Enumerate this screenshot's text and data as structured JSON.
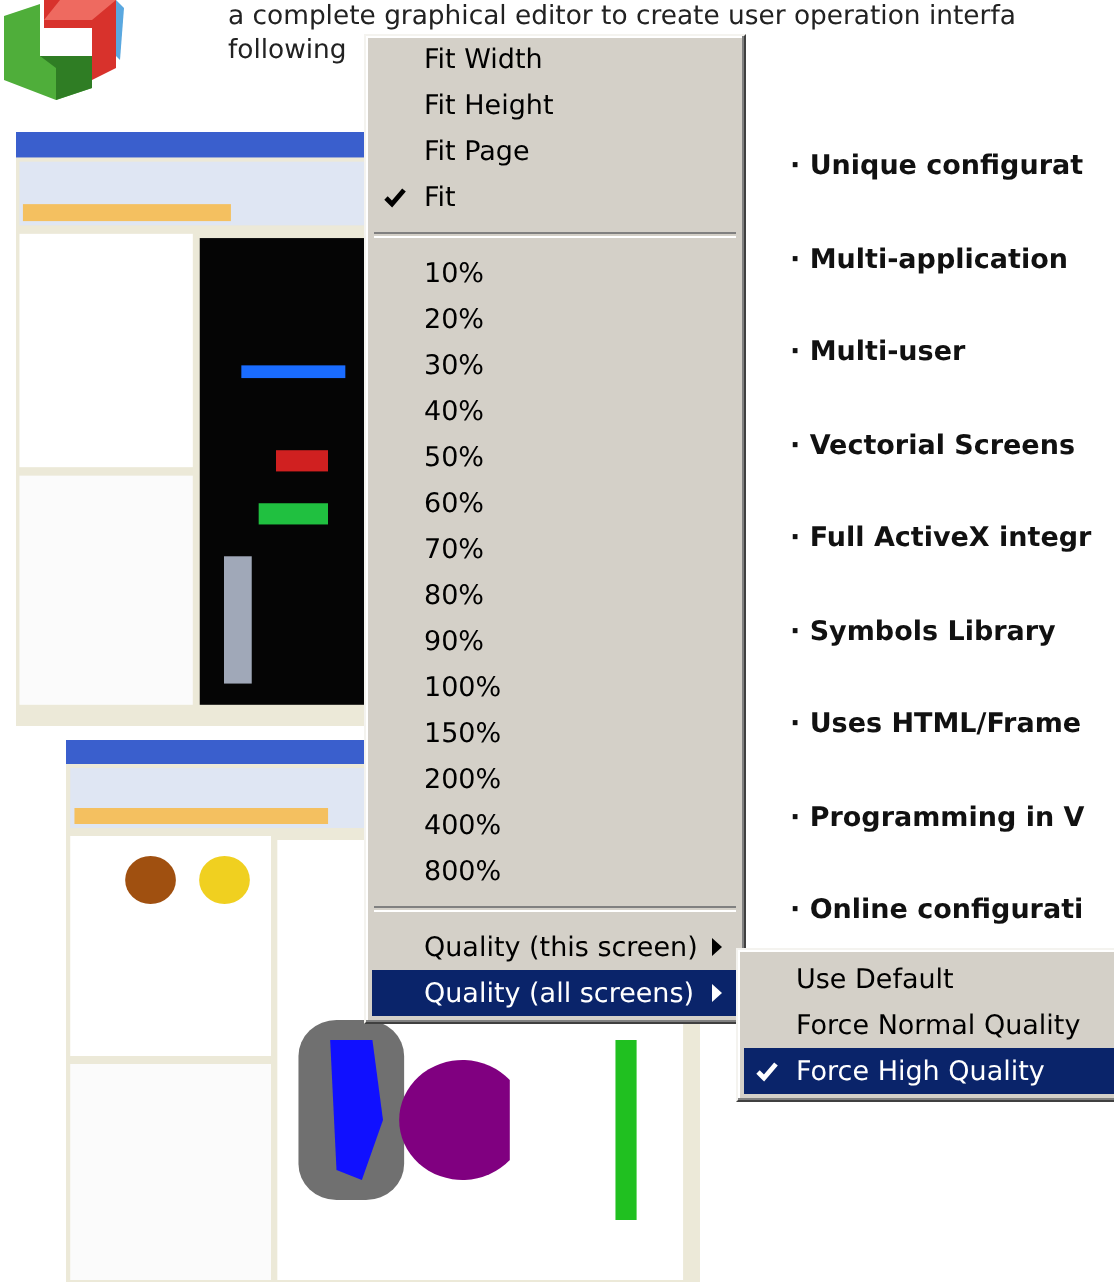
{
  "header": {
    "lines": [
      "a complete graphical editor to create user operation interfa",
      "following"
    ]
  },
  "features": [
    "· Unique configurat",
    "· Multi-application",
    "· Multi-user",
    "· Vectorial Screens",
    "· Full ActiveX integr",
    "· Symbols Library",
    "· Uses HTML/Frame",
    "· Programming in V",
    "· Online configurati"
  ],
  "context_menu": {
    "items": [
      {
        "kind": "item",
        "label": "Fit Width",
        "checked": false,
        "selected": false
      },
      {
        "kind": "item",
        "label": "Fit Height",
        "checked": false,
        "selected": false
      },
      {
        "kind": "item",
        "label": "Fit Page",
        "checked": false,
        "selected": false
      },
      {
        "kind": "item",
        "label": "Fit",
        "checked": true,
        "selected": false
      },
      {
        "kind": "separator"
      },
      {
        "kind": "item",
        "label": "10%",
        "checked": false,
        "selected": false
      },
      {
        "kind": "item",
        "label": "20%",
        "checked": false,
        "selected": false
      },
      {
        "kind": "item",
        "label": "30%",
        "checked": false,
        "selected": false
      },
      {
        "kind": "item",
        "label": "40%",
        "checked": false,
        "selected": false
      },
      {
        "kind": "item",
        "label": "50%",
        "checked": false,
        "selected": false
      },
      {
        "kind": "item",
        "label": "60%",
        "checked": false,
        "selected": false
      },
      {
        "kind": "item",
        "label": "70%",
        "checked": false,
        "selected": false
      },
      {
        "kind": "item",
        "label": "80%",
        "checked": false,
        "selected": false
      },
      {
        "kind": "item",
        "label": "90%",
        "checked": false,
        "selected": false
      },
      {
        "kind": "item",
        "label": "100%",
        "checked": false,
        "selected": false
      },
      {
        "kind": "item",
        "label": "150%",
        "checked": false,
        "selected": false
      },
      {
        "kind": "item",
        "label": "200%",
        "checked": false,
        "selected": false
      },
      {
        "kind": "item",
        "label": "400%",
        "checked": false,
        "selected": false
      },
      {
        "kind": "item",
        "label": "800%",
        "checked": false,
        "selected": false
      },
      {
        "kind": "separator"
      },
      {
        "kind": "submenu",
        "label": "Quality (this screen)",
        "checked": false,
        "selected": false
      },
      {
        "kind": "submenu",
        "label": "Quality (all screens)",
        "checked": false,
        "selected": true
      }
    ]
  },
  "submenu": {
    "items": [
      {
        "kind": "item",
        "label": "Use Default",
        "checked": false,
        "selected": false
      },
      {
        "kind": "item",
        "label": "Force Normal Quality",
        "checked": false,
        "selected": false
      },
      {
        "kind": "item",
        "label": "Force High Quality",
        "checked": true,
        "selected": true
      }
    ]
  }
}
